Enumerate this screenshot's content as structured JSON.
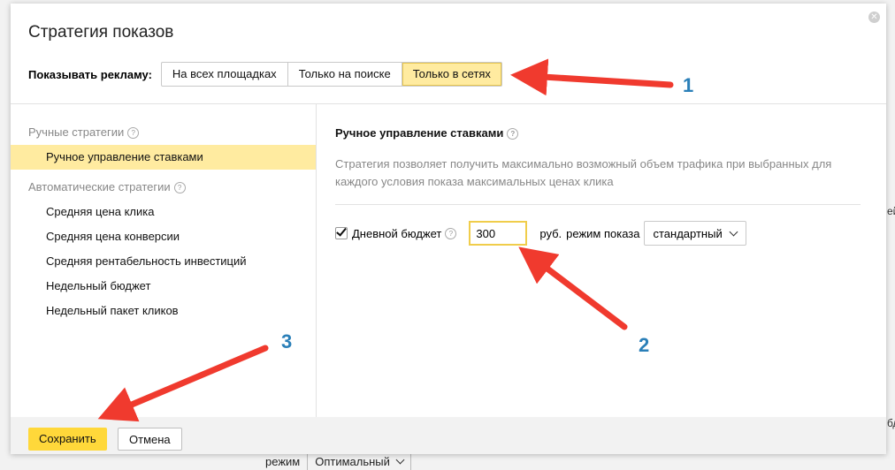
{
  "background": {
    "right_text_a": "ей",
    "right_text_b": "бд",
    "bottom_mode_label": "режим",
    "bottom_mode_value": "Оптимальный"
  },
  "modal": {
    "title": "Стратегия показов",
    "close_icon": "close-icon",
    "show_ads": {
      "label": "Показывать рекламу:",
      "options": [
        "На всех площадках",
        "Только на поиске",
        "Только в сетях"
      ],
      "selected": "Только в сетях"
    },
    "sidebar": {
      "manual_group": "Ручные стратегии",
      "manual_items": [
        "Ручное управление ставками"
      ],
      "auto_group": "Автоматические стратегии",
      "auto_items": [
        "Средняя цена клика",
        "Средняя цена конверсии",
        "Средняя рентабельность инвестиций",
        "Недельный бюджет",
        "Недельный пакет кликов"
      ],
      "selected": "Ручное управление ставками"
    },
    "content": {
      "title": "Ручное управление ставками",
      "description": "Стратегия позволяет получить максимально возможный объем трафика при выбранных для каждого условия показа максимальных ценах клика",
      "budget": {
        "checkbox_label": "Дневной бюджет",
        "checked": true,
        "value": "300",
        "currency": "руб.",
        "mode_label": "режим показа",
        "mode_value": "стандартный"
      }
    },
    "footer": {
      "save_label": "Сохранить",
      "cancel_label": "Отмена"
    }
  },
  "annotations": {
    "labels": [
      "1",
      "2",
      "3"
    ],
    "arrow_color": "#f03a2e",
    "number_color": "#2a7fb8"
  },
  "colors": {
    "selected_bg": "#ffeba0",
    "save_button": "#ffd83a"
  }
}
